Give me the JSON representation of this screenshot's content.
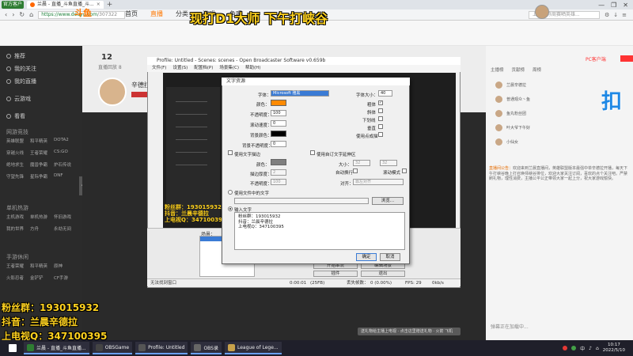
{
  "browser": {
    "badge": "官方客户端",
    "tab_title": "兰晨 - 直播_斗鱼直播_斗...",
    "tab_close": "×",
    "new_tab": "+",
    "url_host": "https://www.douyu.com",
    "url_path": "/307322",
    "search_placeholder": "上海日称周赛晒英雄...",
    "win_ctrls": [
      "—",
      "❐",
      "✕"
    ]
  },
  "overlay_title": "现打D1大师 下午打峡谷",
  "site": {
    "logo": "斗鱼",
    "nav": [
      "首页",
      "直播",
      "分类",
      "游戏",
      "鱼吧"
    ],
    "nav_active_index": 1
  },
  "sidebar": {
    "items": [
      "推荐",
      "我的关注",
      "我的直播",
      "云游戏",
      "看看"
    ],
    "sections": [
      {
        "title": "网游竞技",
        "games": [
          "英雄联盟",
          "和平精英",
          "DOTA2",
          "穿越火线",
          "王者荣耀",
          "CS:GO",
          "绝地求生",
          "魔兽争霸",
          "炉石传说",
          "守望先锋",
          "星际争霸",
          "DNF"
        ]
      },
      {
        "title": "单机热游",
        "games": [
          "主机游戏",
          "单机热游",
          "怀旧游戏",
          "我的世界",
          "方舟",
          "永劫无间"
        ]
      },
      {
        "title": "手游休闲",
        "games": [
          "王者荣耀",
          "和平精英",
          "原神",
          "火影忍者",
          "金铲铲",
          "CF手游"
        ]
      }
    ],
    "collapse_glyph": "‹"
  },
  "streamer": {
    "room_count": "12",
    "room_sub": "直播回放 8",
    "name": "辛德拉"
  },
  "obs": {
    "title": "Profile: Untitled - Scenes: scenes - Open Broadcaster Software v0.659b",
    "menu": [
      "文件(F)",
      "设置(S)",
      "配置档(P)",
      "场景集(C)",
      "帮助(H)"
    ],
    "preview_overlay_lines": [
      "粉丝群：193015932",
      "抖音：兰晨辛德拉",
      "上电视Q：347100395"
    ],
    "scenes_label": "场景：",
    "buttons": [
      "设置",
      "开始串流",
      "编辑场景",
      "退出",
      "插件",
      "录制"
    ],
    "status": {
      "left": "无法找到窗口",
      "time": "0:00:01",
      "dropped_label": "丢失帧数：",
      "dropped_value": "0 (0.00%)",
      "fps": "FPS: 29",
      "bitrate": "0kb/s",
      "size": "(25FB)"
    }
  },
  "dialog": {
    "title": "文字资源",
    "font_label": "字体：",
    "font_value": "Microsoft 雅黑",
    "font_size_label": "字体大小：",
    "font_size_value": "40",
    "color_label": "颜色：",
    "color_value": "#ff8a00",
    "opacity_label": "不透明度：",
    "opacity_value": "100",
    "scroll_label": "滚动速度：",
    "scroll_value": "0",
    "bg_color_label": "背景颜色：",
    "bg_color_value": "#000000",
    "bg_opacity_label": "背景不透明度：",
    "bg_opacity_value": "0",
    "bold_label": "粗体",
    "italic_label": "斜体",
    "underline_label": "下划线",
    "vertical_label": "垂直",
    "outline_label": "使用点成描",
    "bold_checked": "✓",
    "use_outline_label": "使用文字描边",
    "outline_color_label": "颜色：",
    "outline_color_value": "#7f7f7f",
    "outline_thickness_label": "描边厚度：",
    "outline_thickness_value": "2",
    "outline_opacity_label": "不透明度：",
    "outline_opacity_value": "100",
    "custom_extents_label": "使用自订文字延伸区",
    "size_label": "大小：",
    "size_w": "32",
    "size_h": "32",
    "wrap_label": "自动换行",
    "scroll_mode_label": "滚动模式",
    "align_label": "对齐：",
    "align_value": "靠左对齐",
    "from_file_label": "使用文件中的文字",
    "browse_label": "浏览...",
    "input_label": "输入文字",
    "input_text": "粉丝群：193015932\n抖音：兰晨辛德拉\n上电视Q：347100395",
    "ok_label": "确定",
    "cancel_label": "取消"
  },
  "right_panel": {
    "pc_label": "PC客户端",
    "tabs": [
      "主播榜",
      "贡献榜",
      "周榜"
    ],
    "ranks": [
      "兰晨辛德拉",
      "普通观众丶鱼",
      "鱼丸粉丝团",
      "叶大爷下午好",
      "小仙女"
    ],
    "announce_title": "直播间公告：",
    "announce_text": "欢迎来到兰晨直播间，英雄联盟版本最强中单辛德拉开播，每天下午打峡谷晚上打召唤师峡谷排位，欢迎大家关注订阅，喜欢的点个关注吧。严禁刷礼物，理性消费，主播公平公正带领大家一起上分，祝大家游戏愉快。",
    "big_char": "扣",
    "chat_foot": "弹幕正在加载中..."
  },
  "bottom_overlay": [
    "粉丝群：193015932",
    "抖音：兰晨辛德拉",
    "上电视Q：347100395"
  ],
  "gift_bar_text": "送礼物给主播上电视 · 点击这里赠送礼物 · 火箭 飞机",
  "taskbar": {
    "apps": [
      "兰晨 - 直播_斗鱼直播...",
      "OBSGame",
      "Profile: Untitled",
      "OBS录",
      "League of Lege..."
    ],
    "time": "10:17",
    "date": "2022/5/10",
    "tray": [
      "中",
      "♪",
      "⌂"
    ]
  },
  "colors": {
    "accent": "#ff7700",
    "overlay_yellow": "#ffd21f",
    "dark_bg": "#2a2a2a",
    "taskbar": "#1f1f2a"
  }
}
